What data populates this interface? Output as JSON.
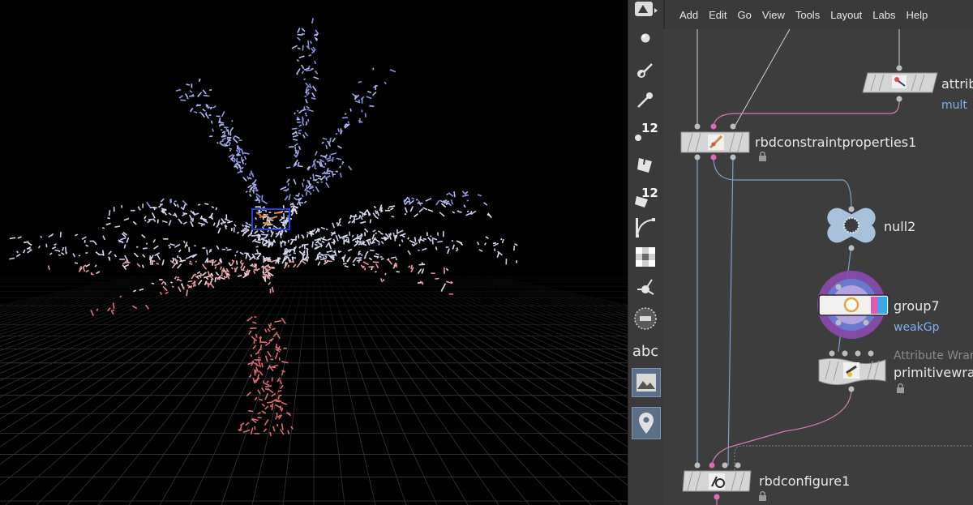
{
  "menubar": {
    "items": [
      "Add",
      "Edit",
      "Go",
      "View",
      "Tools",
      "Layout",
      "Labs",
      "Help"
    ]
  },
  "toolbar": {
    "tools": [
      {
        "name": "view-mode-icon"
      },
      {
        "name": "point-icon"
      },
      {
        "name": "paint-brush-icon"
      },
      {
        "name": "pin-icon"
      },
      {
        "name": "point-numbers-icon",
        "badge": "12"
      },
      {
        "name": "primitive-fill-icon"
      },
      {
        "name": "primitive-numbers-icon",
        "badge": "12"
      },
      {
        "name": "curve-icon"
      },
      {
        "name": "checker-icon"
      },
      {
        "name": "normal-icon"
      },
      {
        "name": "hull-icon"
      },
      {
        "name": "abc-text-icon",
        "text": "abc"
      },
      {
        "name": "image-icon"
      },
      {
        "name": "marker-icon"
      }
    ]
  },
  "nodes": {
    "attrib": {
      "label": "attrib",
      "sub": "mult"
    },
    "rbdconstraintproperties1": {
      "label": "rbdconstraintproperties1"
    },
    "null2": {
      "label": "null2"
    },
    "group7": {
      "label": "group7",
      "sub": "weakGp"
    },
    "primitivewrangle": {
      "comment": "Attribute Wran",
      "label": "primitivewra"
    },
    "rbdconfigure1": {
      "label": "rbdconfigure1"
    }
  },
  "colors": {
    "viewport_bg": "#000000",
    "network_bg": "#3d3d3d",
    "wire_pink": "#d47ab4",
    "wire_blue": "#7d9ed0",
    "param_blue": "#7fb0ec",
    "tree_blue": "#8c95e6",
    "tree_pink": "#e67a80"
  }
}
